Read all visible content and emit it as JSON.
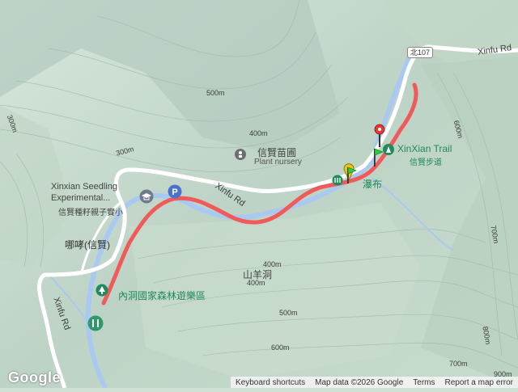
{
  "map": {
    "roads": {
      "xinfu_rd_upper": "Xinfu Rd",
      "xinfu_rd_middle": "Xinfu Rd",
      "xinfu_rd_lower": "Xinfu Rd",
      "route_shield": "北107"
    },
    "places": {
      "plant_nursery_zh": "信賢苗圃",
      "plant_nursery_en": "Plant nursery",
      "xinxian_trail_en": "XinXian Trail",
      "xinxian_trail_zh": "信賢步道",
      "waterfall_zh": "瀑布",
      "school_en_line1": "Xinxian Seedling",
      "school_en_line2": "Experimental...",
      "school_zh": "信賢種籽親子實小",
      "village": "哪哮(信賢)",
      "mountain": "山羊洞",
      "forest_park": "內洞國家森林遊樂區"
    },
    "contours": [
      "300m",
      "400m",
      "500m",
      "300m",
      "400m",
      "600m",
      "700m",
      "400m",
      "500m",
      "600m",
      "700m",
      "800m",
      "900m"
    ],
    "colors": {
      "track": "#f05a5a",
      "river": "#a9c9f0",
      "road": "#ffffff",
      "poi_green": "#1f8a5b",
      "start_flag": "#2ecc40",
      "end_pin": "#e53935",
      "yellow_marker": "#f1c40f"
    },
    "icons": [
      "plant-nursery-icon",
      "trail-icon",
      "school-icon",
      "parking-icon",
      "park-icon",
      "hiking-icon",
      "start-flag-icon",
      "end-pin-icon"
    ]
  },
  "footer": {
    "brand": "Google",
    "shortcuts": "Keyboard shortcuts",
    "data": "Map data ©2026 Google",
    "terms": "Terms",
    "report": "Report a map error"
  }
}
